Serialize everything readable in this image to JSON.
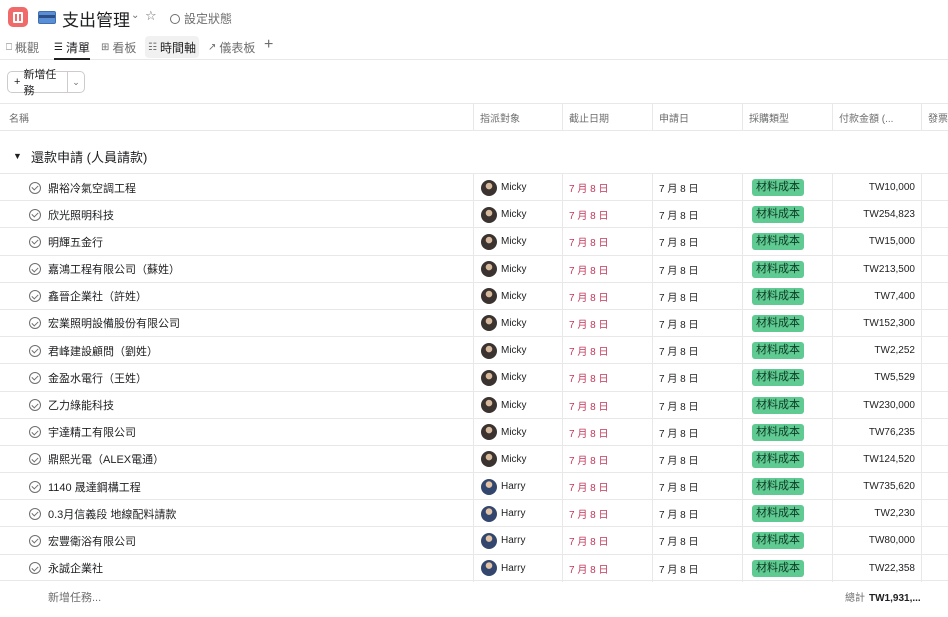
{
  "header": {
    "title": "支出管理",
    "status_label": "設定狀態"
  },
  "tabs": [
    {
      "label": "概觀",
      "icon": "overview-icon"
    },
    {
      "label": "清單",
      "icon": "list-icon",
      "active": true
    },
    {
      "label": "看板",
      "icon": "board-icon"
    },
    {
      "label": "時間軸",
      "icon": "timeline-icon"
    },
    {
      "label": "儀表板",
      "icon": "dashboard-icon"
    }
  ],
  "toolbar": {
    "add_task_label": "新增任務"
  },
  "columns": {
    "name": "名稱",
    "assignee": "指派對象",
    "due": "截止日期",
    "apply": "申請日",
    "type": "採購類型",
    "amount": "付款金額 (...",
    "extra": "發票"
  },
  "section": {
    "label": "還款申請 (人員請款)"
  },
  "rows": [
    {
      "name": "鼎裕冷氣空調工程",
      "assignee": "Micky",
      "due": "7 月 8 日",
      "apply": "7 月 8 日",
      "type": "材料成本",
      "amount": "TW10,000"
    },
    {
      "name": "欣光照明科技",
      "assignee": "Micky",
      "due": "7 月 8 日",
      "apply": "7 月 8 日",
      "type": "材料成本",
      "amount": "TW254,823"
    },
    {
      "name": "明輝五金行",
      "assignee": "Micky",
      "due": "7 月 8 日",
      "apply": "7 月 8 日",
      "type": "材料成本",
      "amount": "TW15,000"
    },
    {
      "name": "嘉鴻工程有限公司（蘇姓）",
      "assignee": "Micky",
      "due": "7 月 8 日",
      "apply": "7 月 8 日",
      "type": "材料成本",
      "amount": "TW213,500"
    },
    {
      "name": "鑫晉企業社（許姓）",
      "assignee": "Micky",
      "due": "7 月 8 日",
      "apply": "7 月 8 日",
      "type": "材料成本",
      "amount": "TW7,400"
    },
    {
      "name": "宏業照明設備股份有限公司",
      "assignee": "Micky",
      "due": "7 月 8 日",
      "apply": "7 月 8 日",
      "type": "材料成本",
      "amount": "TW152,300"
    },
    {
      "name": "君峰建設顧問（劉姓）",
      "assignee": "Micky",
      "due": "7 月 8 日",
      "apply": "7 月 8 日",
      "type": "材料成本",
      "amount": "TW2,252"
    },
    {
      "name": "金盈水電行（王姓）",
      "assignee": "Micky",
      "due": "7 月 8 日",
      "apply": "7 月 8 日",
      "type": "材料成本",
      "amount": "TW5,529"
    },
    {
      "name": "乙力綠能科技",
      "assignee": "Micky",
      "due": "7 月 8 日",
      "apply": "7 月 8 日",
      "type": "材料成本",
      "amount": "TW230,000"
    },
    {
      "name": "宇達精工有限公司",
      "assignee": "Micky",
      "due": "7 月 8 日",
      "apply": "7 月 8 日",
      "type": "材料成本",
      "amount": "TW76,235"
    },
    {
      "name": "鼎熙光電（ALEX電通）",
      "assignee": "Micky",
      "due": "7 月 8 日",
      "apply": "7 月 8 日",
      "type": "材料成本",
      "amount": "TW124,520"
    },
    {
      "name": "1140 晟達鋼構工程",
      "assignee": "Harry",
      "due": "7 月 8 日",
      "apply": "7 月 8 日",
      "type": "材料成本",
      "amount": "TW735,620"
    },
    {
      "name": "0.3月信義段 地線配料請款",
      "assignee": "Harry",
      "due": "7 月 8 日",
      "apply": "7 月 8 日",
      "type": "材料成本",
      "amount": "TW2,230"
    },
    {
      "name": "宏豐衛浴有限公司",
      "assignee": "Harry",
      "due": "7 月 8 日",
      "apply": "7 月 8 日",
      "type": "材料成本",
      "amount": "TW80,000"
    },
    {
      "name": "永誠企業社",
      "assignee": "Harry",
      "due": "7 月 8 日",
      "apply": "7 月 8 日",
      "type": "材料成本",
      "amount": "TW22,358"
    }
  ],
  "footer": {
    "new_task_label": "新增任務...",
    "total_label": "總計",
    "total_value": "TW1,931,..."
  },
  "colors": {
    "brand": "#f06a6a",
    "due_date": "#c0365a",
    "tag_bg": "#5fca91"
  }
}
